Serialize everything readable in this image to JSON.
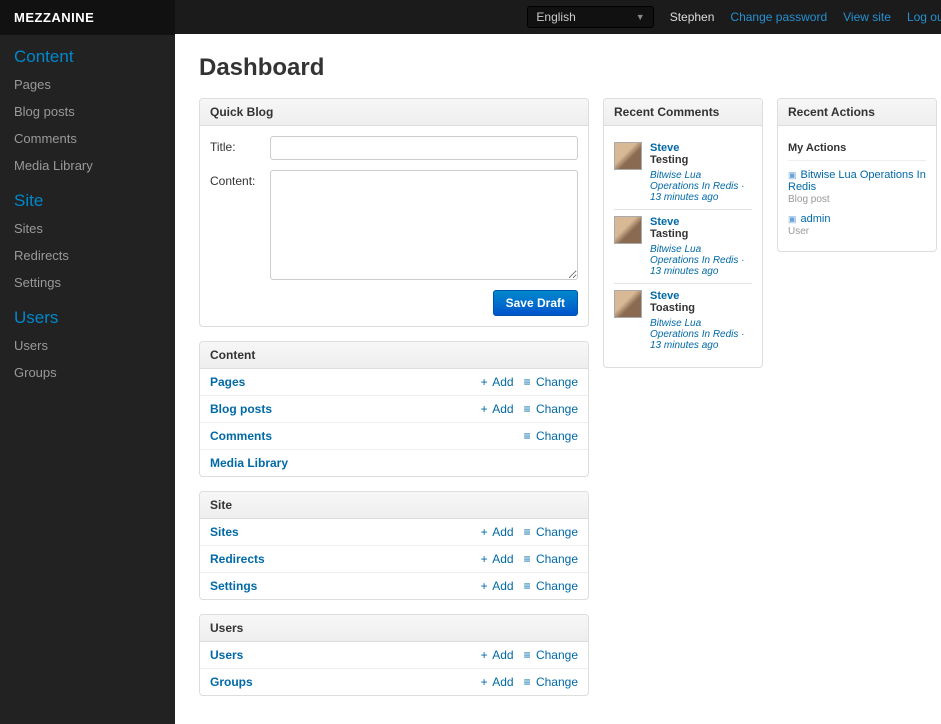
{
  "brand": "MEZZANINE",
  "topbar": {
    "language": "English",
    "user": "Stephen",
    "change_password": "Change password",
    "view_site": "View site",
    "log_out": "Log out"
  },
  "sidebar": {
    "sections": [
      {
        "title": "Content",
        "items": [
          "Pages",
          "Blog posts",
          "Comments",
          "Media Library"
        ]
      },
      {
        "title": "Site",
        "items": [
          "Sites",
          "Redirects",
          "Settings"
        ]
      },
      {
        "title": "Users",
        "items": [
          "Users",
          "Groups"
        ]
      }
    ]
  },
  "page_title": "Dashboard",
  "quick_blog": {
    "panel_title": "Quick Blog",
    "title_label": "Title:",
    "content_label": "Content:",
    "title_value": "",
    "content_value": "",
    "save_button": "Save Draft"
  },
  "module_groups": [
    {
      "title": "Content",
      "rows": [
        {
          "name": "Pages",
          "add": "Add",
          "change": "Change"
        },
        {
          "name": "Blog posts",
          "add": "Add",
          "change": "Change"
        },
        {
          "name": "Comments",
          "add": null,
          "change": "Change"
        },
        {
          "name": "Media Library",
          "add": null,
          "change": null
        }
      ]
    },
    {
      "title": "Site",
      "rows": [
        {
          "name": "Sites",
          "add": "Add",
          "change": "Change"
        },
        {
          "name": "Redirects",
          "add": "Add",
          "change": "Change"
        },
        {
          "name": "Settings",
          "add": "Add",
          "change": "Change"
        }
      ]
    },
    {
      "title": "Users",
      "rows": [
        {
          "name": "Users",
          "add": "Add",
          "change": "Change"
        },
        {
          "name": "Groups",
          "add": "Add",
          "change": "Change"
        }
      ]
    }
  ],
  "recent_comments": {
    "panel_title": "Recent Comments",
    "items": [
      {
        "author": "Steve",
        "text": "Testing",
        "meta": "Bitwise Lua Operations In Redis · 13 minutes ago"
      },
      {
        "author": "Steve",
        "text": "Tasting",
        "meta": "Bitwise Lua Operations In Redis · 13 minutes ago"
      },
      {
        "author": "Steve",
        "text": "Toasting",
        "meta": "Bitwise Lua Operations In Redis · 13 minutes ago"
      }
    ]
  },
  "recent_actions": {
    "panel_title": "Recent Actions",
    "subhead": "My Actions",
    "items": [
      {
        "name": "Bitwise Lua Operations In Redis",
        "type": "Blog post"
      },
      {
        "name": "admin",
        "type": "User"
      }
    ]
  },
  "symbols": {
    "plus": "+",
    "list": "≡"
  }
}
